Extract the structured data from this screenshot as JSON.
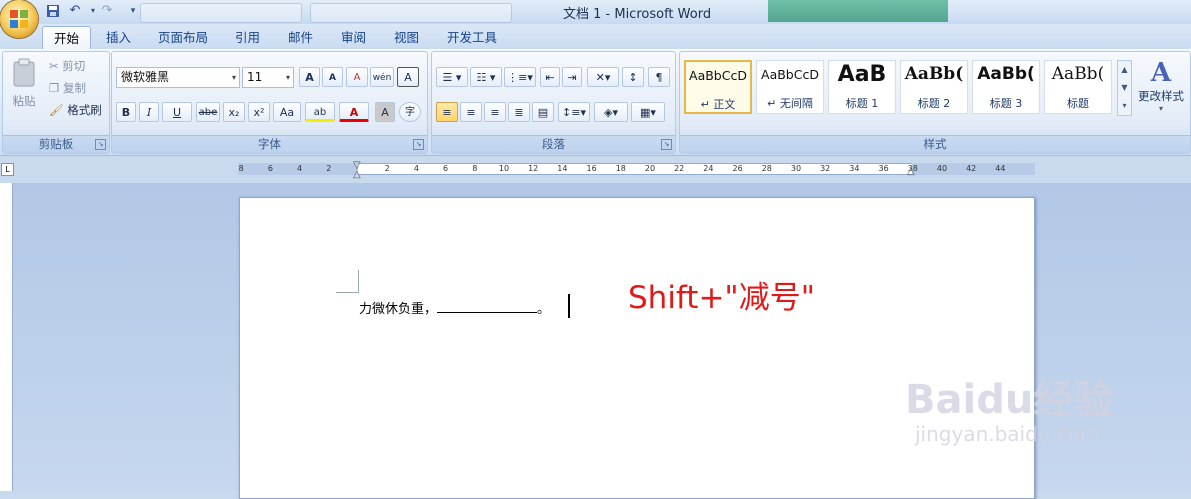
{
  "window": {
    "title": "文档 1 - Microsoft Word",
    "quick_access": [
      "save-icon",
      "undo-icon",
      "redo-icon",
      "customize-icon"
    ]
  },
  "tabs": [
    "开始",
    "插入",
    "页面布局",
    "引用",
    "邮件",
    "审阅",
    "视图",
    "开发工具"
  ],
  "clipboard": {
    "paste": "粘贴",
    "cut": "剪切",
    "copy": "复制",
    "format_painter": "格式刷",
    "group_label": "剪贴板"
  },
  "font": {
    "name": "微软雅黑",
    "size": "11",
    "group_label": "字体",
    "bold": "B",
    "italic": "I",
    "underline": "U",
    "strike": "abe",
    "subscript": "x₂",
    "superscript": "x²",
    "change_case": "Aa",
    "highlight": "ab",
    "font_color": "A",
    "grow": "A",
    "shrink": "A",
    "clear_format": "A",
    "phonetic": "wén",
    "char_border": "A",
    "enclose": "字",
    "char_shading": "A"
  },
  "paragraph": {
    "group_label": "段落"
  },
  "styles": {
    "group_label": "样式",
    "change_styles": "更改样式",
    "items": [
      {
        "sample": "AaBbCcD",
        "name": "↵ 正文"
      },
      {
        "sample": "AaBbCcD",
        "name": "↵ 无间隔"
      },
      {
        "sample": "AaB",
        "name": "标题 1"
      },
      {
        "sample": "AaBb(",
        "name": "标题 2"
      },
      {
        "sample": "AaBb(",
        "name": "标题 3"
      },
      {
        "sample": "AaBb(",
        "name": "标题"
      }
    ]
  },
  "ruler": {
    "left_numbers": [
      "8",
      "6",
      "4",
      "2"
    ],
    "right_numbers": [
      "2",
      "4",
      "6",
      "8",
      "10",
      "12",
      "14",
      "16",
      "18",
      "20",
      "22",
      "24",
      "26",
      "28",
      "30",
      "32",
      "34",
      "36",
      "38",
      "40",
      "42",
      "44"
    ]
  },
  "document": {
    "text_before": "力微休负重，",
    "text_after": "。"
  },
  "annotation": "Shift+\"减号\"",
  "watermark": {
    "brand": "Baidu经验",
    "url": "jingyan.baidu.com"
  },
  "colors": {
    "accent": "#15428b",
    "annotation": "#e01919",
    "ribbon": "#dfe9f6"
  }
}
